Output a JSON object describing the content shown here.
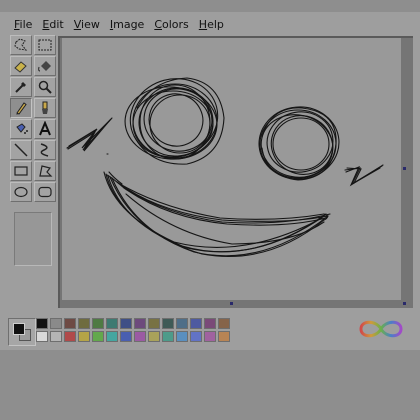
{
  "menu": [
    {
      "accel": "F",
      "rest": "ile"
    },
    {
      "accel": "E",
      "rest": "dit"
    },
    {
      "accel": "V",
      "rest": "iew"
    },
    {
      "accel": "I",
      "rest": "mage"
    },
    {
      "accel": "C",
      "rest": "olors"
    },
    {
      "accel": "H",
      "rest": "elp"
    }
  ],
  "tools": [
    "free-form-select-icon",
    "rect-select-icon",
    "eraser-icon",
    "fill-bucket-icon",
    "color-picker-icon",
    "magnifier-icon",
    "pencil-icon",
    "brush-icon",
    "airbrush-icon",
    "text-icon",
    "line-icon",
    "curve-icon",
    "rectangle-icon",
    "polygon-icon",
    "ellipse-icon",
    "rounded-rect-icon"
  ],
  "selected_tool": "pencil-icon",
  "palette_colors": [
    "#111111",
    "#8a8a8a",
    "#6e4a44",
    "#6f6c3f",
    "#4f7a43",
    "#3e7a72",
    "#3f4f86",
    "#6d4a7c",
    "#787243",
    "#3f5a56",
    "#4f6e88",
    "#4e5aa0",
    "#7a4a78",
    "#86644a",
    "#d9d9d9",
    "#b5b5b5",
    "#b04a4a",
    "#b5a447",
    "#63a84c",
    "#45a6a0",
    "#4a5fb0",
    "#9b5aa3",
    "#a9a25a",
    "#4d9b8a",
    "#5a8fbf",
    "#6273c5",
    "#a0629f",
    "#b88454"
  ],
  "foreground_color": "#111111",
  "background_color": "#9a9a9a",
  "logo_icon": "infinity-logo"
}
